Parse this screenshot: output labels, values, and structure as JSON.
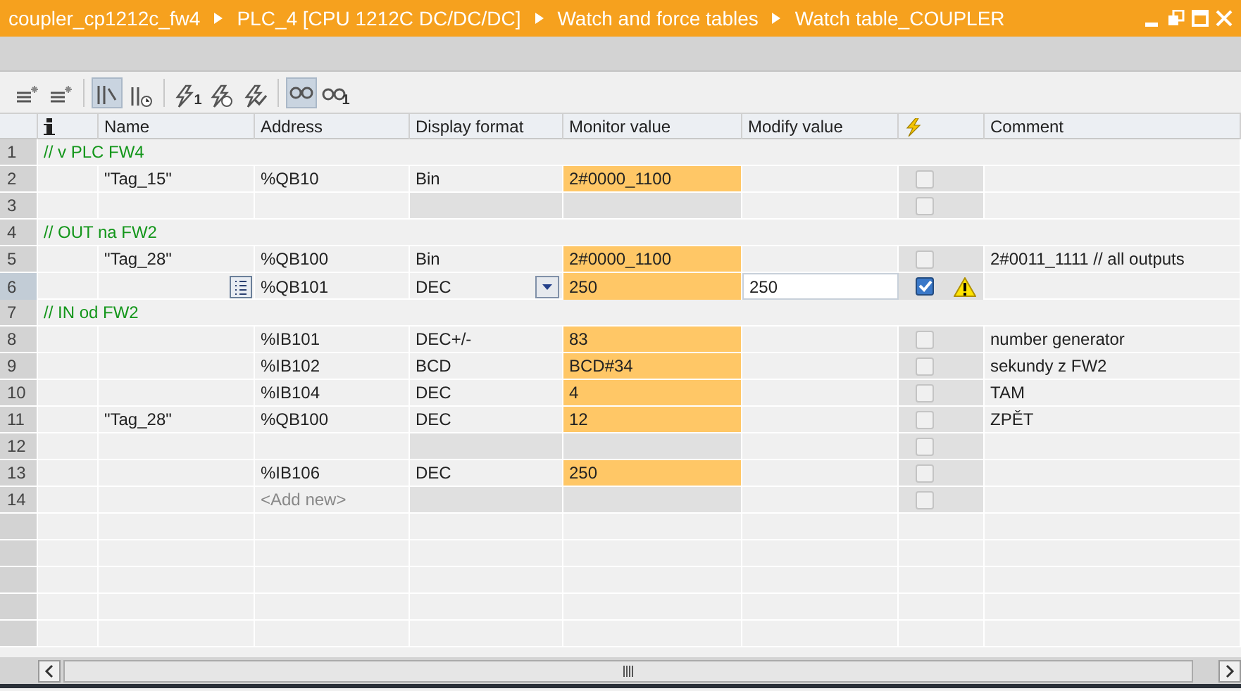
{
  "breadcrumb": [
    "coupler_cp1212c_fw4",
    "PLC_4 [CPU 1212C DC/DC/DC]",
    "Watch and force tables",
    "Watch table_COUPLER"
  ],
  "toolbar": [
    {
      "kind": "insert",
      "active": false
    },
    {
      "kind": "insert",
      "active": false
    },
    {
      "kind": "columns",
      "active": true
    },
    {
      "kind": "clock",
      "active": false
    },
    {
      "kind": "bolt",
      "badge": "1",
      "active": false
    },
    {
      "kind": "boltclock",
      "active": false
    },
    {
      "kind": "boltcheck",
      "active": false
    },
    {
      "kind": "glasses",
      "active": true
    },
    {
      "kind": "glasses",
      "badge": "1",
      "active": false
    }
  ],
  "columns": [
    "Name",
    "Address",
    "Display format",
    "Monitor value",
    "Modify value",
    "Comment"
  ],
  "rows": [
    {
      "kind": "comment",
      "num": "1",
      "text": "// v PLC FW4"
    },
    {
      "kind": "tag",
      "num": "2",
      "name": "\"Tag_15\"",
      "address": "%QB10",
      "format": "Bin",
      "monitor": "2#0000_1100",
      "force": false,
      "warning": false,
      "editing": false,
      "selected": false
    },
    {
      "kind": "tag",
      "num": "3",
      "force": false,
      "warning": false,
      "editing": false,
      "selected": false
    },
    {
      "kind": "comment",
      "num": "4",
      "text": "// OUT na FW2"
    },
    {
      "kind": "tag",
      "num": "5",
      "name": "\"Tag_28\"",
      "address": "%QB100",
      "format": "Bin",
      "monitor": "2#0000_1100",
      "force": false,
      "warning": false,
      "editing": false,
      "selected": false,
      "comment": "2#0011_1111 // all outputs"
    },
    {
      "kind": "tag",
      "num": "6",
      "address": "%QB101",
      "format": "DEC",
      "monitor": "250",
      "modify": "250",
      "force": true,
      "warning": true,
      "editing": true,
      "selected": true
    },
    {
      "kind": "comment",
      "num": "7",
      "text": "// IN od FW2"
    },
    {
      "kind": "tag",
      "num": "8",
      "address": "%IB101",
      "format": "DEC+/-",
      "monitor": "83",
      "force": false,
      "warning": false,
      "editing": false,
      "selected": false,
      "comment": "number generator"
    },
    {
      "kind": "tag",
      "num": "9",
      "address": "%IB102",
      "format": "BCD",
      "monitor": "BCD#34",
      "force": false,
      "warning": false,
      "editing": false,
      "selected": false,
      "comment": "sekundy z FW2"
    },
    {
      "kind": "tag",
      "num": "10",
      "address": "%IB104",
      "format": "DEC",
      "monitor": "4",
      "force": false,
      "warning": false,
      "editing": false,
      "selected": false,
      "comment": "TAM"
    },
    {
      "kind": "tag",
      "num": "11",
      "name": "\"Tag_28\"",
      "address": "%QB100",
      "format": "DEC",
      "monitor": "12",
      "force": false,
      "warning": false,
      "editing": false,
      "selected": false,
      "comment": "ZPĚT"
    },
    {
      "kind": "tag",
      "num": "12",
      "force": false,
      "warning": false,
      "editing": false,
      "selected": false
    },
    {
      "kind": "tag",
      "num": "13",
      "address": "%IB106",
      "format": "DEC",
      "monitor": "250",
      "force": false,
      "warning": false,
      "editing": false,
      "selected": false
    },
    {
      "kind": "add",
      "num": "14",
      "placeholder": "<Add new>",
      "force": false,
      "selected": false
    }
  ]
}
